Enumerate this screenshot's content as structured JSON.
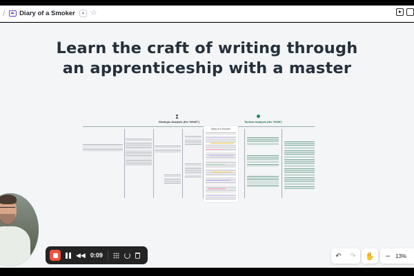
{
  "topbar": {
    "breadcrumb_separator": "/",
    "doc_title": "Diary of a Smoker",
    "dropdown_glyph": "▾",
    "star_glyph": "☆"
  },
  "canvas": {
    "headline_line1": "Learn the craft of writing through",
    "headline_line2": "an apprenticeship with a master"
  },
  "board": {
    "strategic_heading": "Strategic Analysis (the 'WHAT')",
    "tactical_heading": "Tactical Analysis (the 'HOW')",
    "page_title": "Diary of a Smoker"
  },
  "recorder": {
    "time": "0:09",
    "rewind_glyph": "◀◀"
  },
  "view_controls": {
    "undo_glyph": "↶",
    "redo_glyph": "↷",
    "hand_glyph": "✋",
    "zoom_minus": "–",
    "zoom_level": "13%"
  }
}
